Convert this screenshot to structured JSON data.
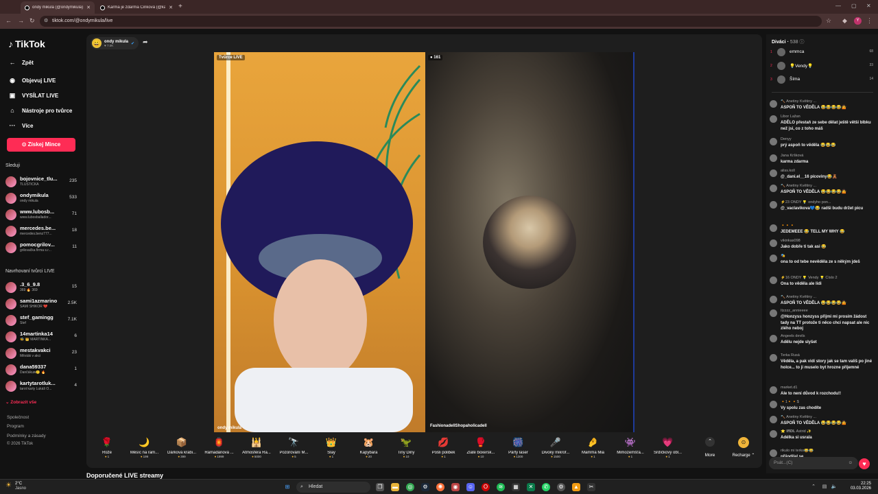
{
  "browser": {
    "tabs": [
      {
        "title": "ondy mikula (@ondymikula) - TikTok"
      },
      {
        "title": "Karma je zdarma Cinková (@kar"
      }
    ],
    "url": "tiktok.com/@ondymikula/live",
    "profile_initial": "Y"
  },
  "sidebar": {
    "logo": "TikTok",
    "back": "Zpět",
    "nav": [
      {
        "label": "Objevuj LIVE",
        "icon": "live-icon"
      },
      {
        "label": "VYSÍLAT LIVE",
        "icon": "broadcast-icon"
      },
      {
        "label": "Nástroje pro tvůrce",
        "icon": "home-tools-icon"
      },
      {
        "label": "Více",
        "icon": "more-icon"
      }
    ],
    "coins_button": "Získej Mince",
    "following_title": "Sleduji",
    "following": [
      {
        "name": "bojovnice_tlu...",
        "sub": "TLUSTÍČKA",
        "count": "235"
      },
      {
        "name": "ondymikula",
        "sub": "ondy mikula",
        "count": "533"
      },
      {
        "name": "www.lubosb...",
        "sub": "www.lubosballador...",
        "count": "71"
      },
      {
        "name": "mercedes.be...",
        "sub": "mercedes.benz777...",
        "count": "18"
      },
      {
        "name": "pomocgrilov...",
        "sub": "grilovačka firma s.r...",
        "count": "11"
      }
    ],
    "suggested_title": "Navrhovaní tvůrci LIVE",
    "suggested": [
      {
        "name": ".3_6_9.8",
        "sub": "369 🔥 369",
        "count": "15"
      },
      {
        "name": "sami1azmarino",
        "sub": "SAMI SHIKOR 💔",
        "count": "2.5K"
      },
      {
        "name": "stef_gamingg",
        "sub": "Stef",
        "count": "7.1K"
      },
      {
        "name": "14martinka14",
        "sub": "🐝 👑 MARTINKA...",
        "count": "6"
      },
      {
        "name": "mestakvakci",
        "sub": "Městák v akci",
        "count": "23"
      },
      {
        "name": "dana59337",
        "sub": "Dančákuw🙂 🔥",
        "count": "1"
      },
      {
        "name": "kartytarotluk...",
        "sub": "tarot karty Lukáš O...",
        "count": "4"
      }
    ],
    "show_all": "Zobrazit vše",
    "footer": [
      "Společnost",
      "Program",
      "Podmínky a zásady",
      "© 2026 TikTok"
    ]
  },
  "host": {
    "name": "ondy mikula",
    "sub": "7.0K"
  },
  "stream": {
    "left_tag": "Tvůrce LIVE",
    "left_name": "ondy mikula",
    "right_tag": "161",
    "right_name": "FashionadellShopaholicadell"
  },
  "gifts": [
    {
      "name": "Růže",
      "price": "1",
      "icon": "🌹"
    },
    {
      "name": "Měsíc na ram...",
      "price": "199",
      "icon": "🌙"
    },
    {
      "name": "Dárková krabi...",
      "price": "399",
      "icon": "📦"
    },
    {
      "name": "Ramadánová ...",
      "price": "1999",
      "icon": "🏮"
    },
    {
      "name": "Atmosféra Ra...",
      "price": "5000",
      "icon": "🕌"
    },
    {
      "name": "Pozorování M...",
      "price": "5",
      "icon": "🔭"
    },
    {
      "name": "Slay",
      "price": "1",
      "icon": "👑"
    },
    {
      "name": "Kapybara",
      "price": "20",
      "icon": "🐹"
    },
    {
      "name": "Tiny Diny",
      "price": "10",
      "icon": "🦖"
    },
    {
      "name": "Pošli polibek",
      "price": "1",
      "icon": "💋"
    },
    {
      "name": "Zlaté boxersk...",
      "price": "10",
      "icon": "🥊"
    },
    {
      "name": "Párty laser",
      "price": "1300",
      "icon": "🎆"
    },
    {
      "name": "Divoký mikrof...",
      "price": "1500",
      "icon": "🎤"
    },
    {
      "name": "Mamma Mia",
      "price": "1",
      "icon": "🤌"
    },
    {
      "name": "Mimozemšťa...",
      "price": "1",
      "icon": "👾"
    },
    {
      "name": "Srdíčkový obl...",
      "price": "1",
      "icon": "💗"
    }
  ],
  "more_label": "More",
  "recharge_label": "Recharge",
  "recommended": "Doporučené LIVE streamy",
  "panel": {
    "viewers_title": "Diváci",
    "viewers_count": "538",
    "top_viewers": [
      {
        "rank": "1",
        "name": "emmca",
        "score": "68"
      },
      {
        "rank": "2",
        "name": "💡Vendy💡",
        "score": "33"
      },
      {
        "rank": "3",
        "name": "Šíma",
        "score": "14"
      }
    ],
    "comments": [
      {
        "user": "🔨 Anetiny Květiny ...",
        "text": "ASPOŇ TO VĚDĚLA 😂😂😂😂🤷"
      },
      {
        "user": "Libor Lažan",
        "text": "ADĚLO přestaň ze sebe dělat ještě větší blbku než jsi, co z toho máš"
      },
      {
        "user": "Denyy",
        "text": "prý aspoň to věděla 😂😂😂"
      },
      {
        "user": "Jana Kršková",
        "text": "karma zdarma"
      },
      {
        "user": "aliss.koll",
        "text": "@_dani.el__16 pícoviny😂🧸"
      },
      {
        "user": "🔨 Anetiny Květiny ...",
        "text": "ASPOŇ TO VĚDĚLA 😂😂😂😂🤷"
      },
      {
        "user": "⚡23 ONDY 💡 ondyho pon...",
        "text": "@_vaclavikova💙😂 radši budu držet picu"
      },
      {
        "user": "🔸🔸🔸",
        "text": "JEDEMEEE 😂 TELL MY WHY 😂"
      },
      {
        "user": "vikinkas098",
        "text": "Jako dobře ti tak asi 😂"
      },
      {
        "user": "🎭",
        "text": "ona to od tebe nevěděla ze s někým jdeš"
      },
      {
        "user": "⚡16 ONDY 💡 Vendy 💡 Číslo 2",
        "text": "Ona to věděla ale lidi"
      },
      {
        "user": "🔨 Anetiny Květiny ...",
        "text": "ASPOŇ TO VĚDĚLA 😂😂😂😂🤷"
      },
      {
        "user": "Itzzzz_annieeee",
        "text": "@Honzyss honzyss přijmi mi prosím žádost tady na TT protože ti něco chci napsat ale nic zlého neboj"
      },
      {
        "user": "Angeels devils",
        "text": "Adělu nejde slyšet"
      },
      {
        "user": "Terka Rusá",
        "text": "Věděla, a pak vidí story jak se tam valíš po jiné holce... to ji muselo byt hrozne příjemné"
      },
      {
        "user": "market.d1",
        "text": "Ale to není důvod k rozchodu!!"
      },
      {
        "user": "🔸1🔸🔸$",
        "text": "Vy spolu zas chodíte"
      },
      {
        "user": "🔨 Anetiny Květiny ...",
        "text": "ASPOŇ TO VĚDĚLA 😂😂😂😂🤷"
      },
      {
        "user": "⭐ 𝐈𝐑𝐃𝐋 Astrid ✨",
        "text": "Adélka si usrala"
      },
      {
        "user": "rikulo mi terko😂😂 ",
        "text": "přijodilal se"
      }
    ],
    "chat_placeholder": "Psát...(C)"
  },
  "taskbar": {
    "weather_temp": "2°C",
    "weather_desc": "Jasno",
    "search": "Hledat",
    "time": "22:25",
    "date": "03.03.2026"
  }
}
